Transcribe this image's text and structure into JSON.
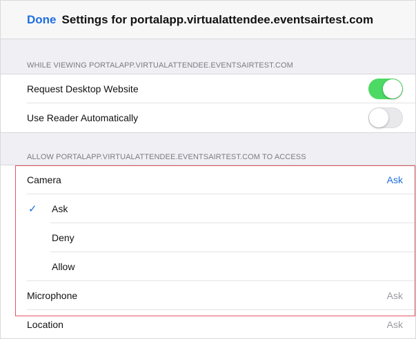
{
  "navbar": {
    "done_label": "Done",
    "title": "Settings for portalapp.virtualattendee.eventsairtest.com"
  },
  "viewing_section": {
    "header": "WHILE VIEWING PORTALAPP.VIRTUALATTENDEE.EVENTSAIRTEST.COM",
    "rows": [
      {
        "label": "Request Desktop Website",
        "toggle": "on"
      },
      {
        "label": "Use Reader Automatically",
        "toggle": "off"
      }
    ]
  },
  "access_section": {
    "header": "ALLOW PORTALAPP.VIRTUALATTENDEE.EVENTSAIRTEST.COM TO ACCESS",
    "camera": {
      "label": "Camera",
      "value": "Ask"
    },
    "camera_options": [
      {
        "label": "Ask",
        "selected": true,
        "check_icon": "checkmark-icon"
      },
      {
        "label": "Deny",
        "selected": false
      },
      {
        "label": "Allow",
        "selected": false
      }
    ],
    "microphone": {
      "label": "Microphone",
      "value": "Ask"
    },
    "location": {
      "label": "Location",
      "value": "Ask"
    }
  },
  "colors": {
    "accent": "#1d6fe0",
    "toggle_on": "#4cd964",
    "highlight": "#e0575f"
  }
}
